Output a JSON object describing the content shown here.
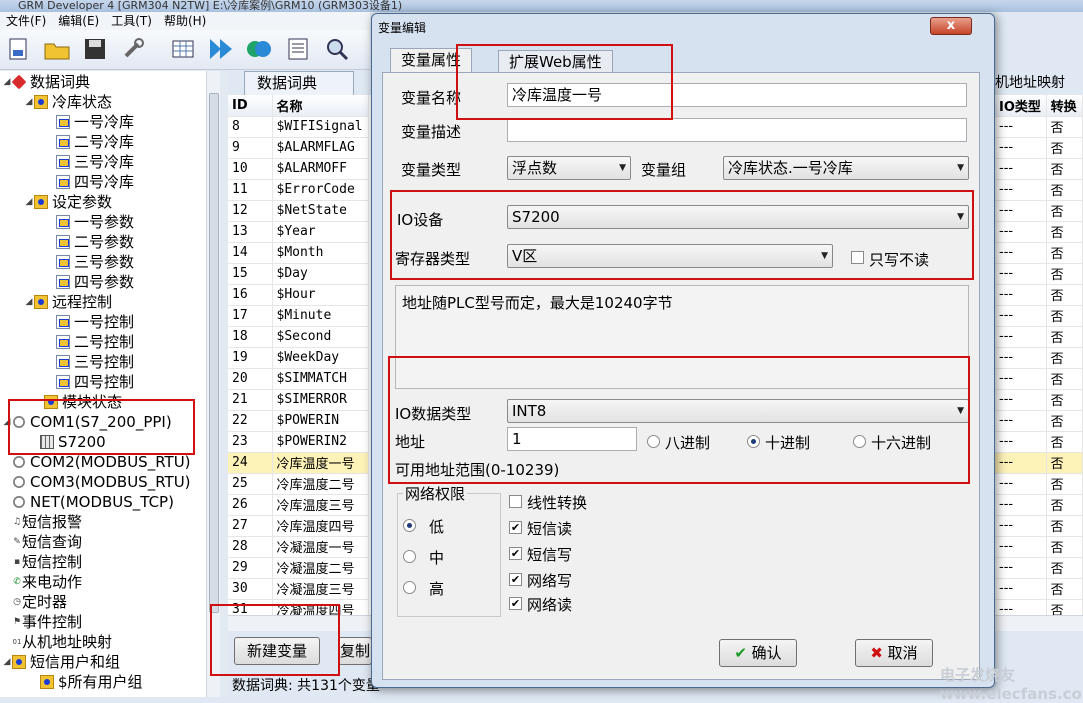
{
  "app": {
    "title": "GRM Developer 4 [GRM304 N2TW]    E:\\冷库案例\\GRM10    (GRM303设备1)"
  },
  "menu": [
    "文件(F)",
    "编辑(E)",
    "工具(T)",
    "帮助(H)"
  ],
  "toolbar": {
    "icons": [
      "new-project-icon",
      "open-folder-icon",
      "save-icon",
      "wrench-icon",
      "grid-icon",
      "play-icon",
      "fast-forward-icon",
      "table-icon",
      "search-icon"
    ]
  },
  "tree": {
    "root": "数据词典",
    "nodes": [
      "冷库状态",
      "一号冷库",
      "二号冷库",
      "三号冷库",
      "四号冷库",
      "设定参数",
      "一号参数",
      "二号参数",
      "三号参数",
      "四号参数",
      "远程控制",
      "一号控制",
      "二号控制",
      "三号控制",
      "四号控制",
      "模块状态",
      "COM1(S7_200_PPI)",
      "S7200",
      "COM2(MODBUS_RTU)",
      "COM3(MODBUS_RTU)",
      "NET(MODBUS_TCP)",
      "短信报警",
      "短信查询",
      "短信控制",
      "来电动作",
      "定时器",
      "事件控制",
      "从机地址映射",
      "短信用户和组",
      "$所有用户组"
    ]
  },
  "tabs": {
    "data_dict": "数据词典",
    "slave_map": "机地址映射"
  },
  "table": {
    "headers": {
      "id": "ID",
      "name": "名称",
      "io_type": "IO类型",
      "convert": "转换"
    },
    "rows": [
      {
        "id": "8",
        "name": "$WIFISignal"
      },
      {
        "id": "9",
        "name": "$ALARMFLAG"
      },
      {
        "id": "10",
        "name": "$ALARMOFF"
      },
      {
        "id": "11",
        "name": "$ErrorCode"
      },
      {
        "id": "12",
        "name": "$NetState"
      },
      {
        "id": "13",
        "name": "$Year"
      },
      {
        "id": "14",
        "name": "$Month"
      },
      {
        "id": "15",
        "name": "$Day"
      },
      {
        "id": "16",
        "name": "$Hour"
      },
      {
        "id": "17",
        "name": "$Minute"
      },
      {
        "id": "18",
        "name": "$Second"
      },
      {
        "id": "19",
        "name": "$WeekDay"
      },
      {
        "id": "20",
        "name": "$SIMMATCH"
      },
      {
        "id": "21",
        "name": "$SIMERROR"
      },
      {
        "id": "22",
        "name": "$POWERIN"
      },
      {
        "id": "23",
        "name": "$POWERIN2"
      },
      {
        "id": "24",
        "name": "冷库温度一号"
      },
      {
        "id": "25",
        "name": "冷库温度二号"
      },
      {
        "id": "26",
        "name": "冷库温度三号"
      },
      {
        "id": "27",
        "name": "冷库温度四号"
      },
      {
        "id": "28",
        "name": "冷凝温度一号"
      },
      {
        "id": "29",
        "name": "冷凝温度二号"
      },
      {
        "id": "30",
        "name": "冷凝温度三号"
      },
      {
        "id": "31",
        "name": "冷凝温度四号"
      }
    ],
    "io_dash": "---",
    "no": "否"
  },
  "buttons": {
    "new_var": "新建变量",
    "copy": "复制"
  },
  "status": "数据词典: 共131个变量",
  "dialog": {
    "title": "变量编辑",
    "close": "x",
    "tab_props": "变量属性",
    "tab_web": "扩展Web属性",
    "var_name_label": "变量名称",
    "var_name": "冷库温度一号",
    "var_desc_label": "变量描述",
    "var_desc": "",
    "var_type_label": "变量类型",
    "var_type": "浮点数",
    "var_group_label": "变量组",
    "var_group": "冷库状态.一号冷库",
    "io_device_label": "IO设备",
    "io_device": "S7200",
    "reg_type_label": "寄存器类型",
    "reg_type": "V区",
    "write_only_label": "只写不读",
    "note": "地址随PLC型号而定，最大是10240字节",
    "io_data_type_label": "IO数据类型",
    "io_data_type": "INT8",
    "addr_label": "地址",
    "addr": "1",
    "octal": "八进制",
    "decimal": "十进制",
    "hex": "十六进制",
    "addr_range": "可用地址范围(0-10239)",
    "net_perm": "网络权限",
    "low": "低",
    "mid": "中",
    "high": "高",
    "linear": "线性转换",
    "sms_read": "短信读",
    "sms_write": "短信写",
    "net_write": "网络写",
    "net_read": "网络读",
    "ok": "确认",
    "cancel": "取消"
  },
  "watermark": "电子发烧友 www.elecfans.com"
}
